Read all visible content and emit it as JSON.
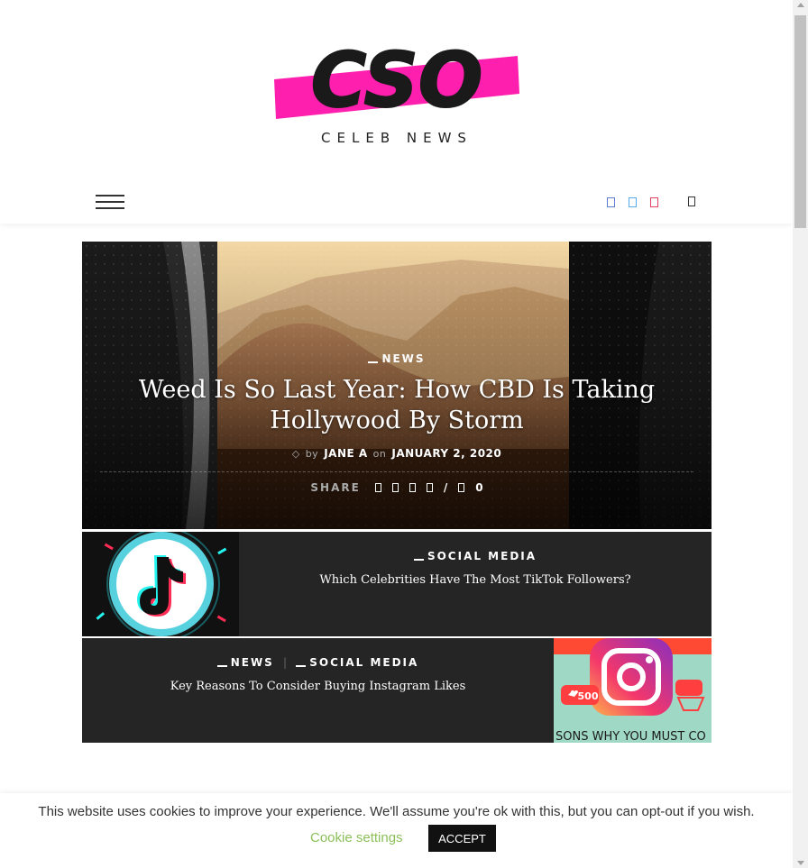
{
  "site": {
    "logo_text": "CSO",
    "logo_subtitle": "CELEB NEWS",
    "brand_color": "#ff1fae"
  },
  "header": {
    "menu_icon": "hamburger-icon",
    "social_icons": [
      {
        "name": "facebook-icon",
        "color": "#5b7bd5"
      },
      {
        "name": "twitter-icon",
        "color": "#55acee"
      },
      {
        "name": "instagram-icon",
        "color": "#e4405f"
      }
    ],
    "search_icon": "search-icon"
  },
  "featured": {
    "category": "NEWS",
    "title": "Weed Is So Last Year: How CBD Is Taking Hollywood By Storm",
    "by_label": "by",
    "author": "JANE A",
    "on_label": "on",
    "date": "JANUARY 2, 2020",
    "share_label": "SHARE",
    "share_icons": [
      "facebook-icon",
      "twitter-icon",
      "pinterest-icon",
      "email-icon"
    ],
    "separator": "/",
    "comment_icon": "comment-icon",
    "comment_count": "0"
  },
  "posts": [
    {
      "categories": [
        "SOCIAL MEDIA"
      ],
      "title": "Which Celebrities Have The Most TikTok Followers?",
      "thumbnail": "tiktok-logo-image"
    },
    {
      "categories": [
        "NEWS",
        "SOCIAL MEDIA"
      ],
      "category_separator": "|",
      "title": "Key Reasons To Consider Buying Instagram Likes",
      "thumbnail": "instagram-logo-image",
      "thumbnail_badge": "500",
      "thumbnail_caption": "SONS WHY YOU MUST CO"
    }
  ],
  "cookie": {
    "message": "This website uses cookies to improve your experience. We'll assume you're ok with this, but you can opt-out if you wish.",
    "settings_label": "Cookie settings",
    "accept_label": "ACCEPT"
  }
}
